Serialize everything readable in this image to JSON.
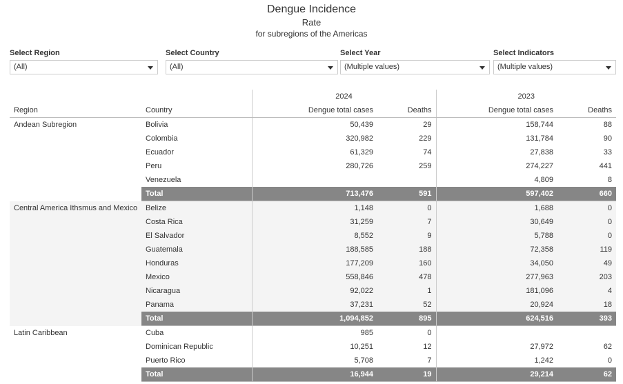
{
  "title": {
    "line1": "Dengue Incidence",
    "line2": "Rate",
    "line3": "for subregions of the Americas"
  },
  "filters": [
    {
      "label": "Select Region",
      "value": "(All)",
      "icon": "chevron-down-icon"
    },
    {
      "label": "Select Country",
      "value": "(All)",
      "icon": "chevron-down-icon"
    },
    {
      "label": "Select Year",
      "value": "(Multiple values)",
      "icon": "chevron-down-icon"
    },
    {
      "label": "Select Indicators",
      "value": "(Multiple values)",
      "icon": "chevron-down-icon"
    }
  ],
  "table": {
    "year_headers": [
      "2024",
      "2023"
    ],
    "column_headers": {
      "region": "Region",
      "country": "Country",
      "cases_2024": "Dengue total cases",
      "deaths_2024": "Deaths",
      "cases_2023": "Dengue total cases",
      "deaths_2023": "Deaths"
    },
    "total_label": "Total",
    "groups": [
      {
        "region": "Andean Subregion",
        "shaded": false,
        "rows": [
          {
            "country": "Bolivia",
            "cases_2024": "50,439",
            "deaths_2024": "29",
            "cases_2023": "158,744",
            "deaths_2023": "88"
          },
          {
            "country": "Colombia",
            "cases_2024": "320,982",
            "deaths_2024": "229",
            "cases_2023": "131,784",
            "deaths_2023": "90"
          },
          {
            "country": "Ecuador",
            "cases_2024": "61,329",
            "deaths_2024": "74",
            "cases_2023": "27,838",
            "deaths_2023": "33"
          },
          {
            "country": "Peru",
            "cases_2024": "280,726",
            "deaths_2024": "259",
            "cases_2023": "274,227",
            "deaths_2023": "441"
          },
          {
            "country": "Venezuela",
            "cases_2024": "",
            "deaths_2024": "",
            "cases_2023": "4,809",
            "deaths_2023": "8"
          }
        ],
        "total": {
          "cases_2024": "713,476",
          "deaths_2024": "591",
          "cases_2023": "597,402",
          "deaths_2023": "660"
        }
      },
      {
        "region": "Central America Ithsmus and Mexico",
        "shaded": true,
        "rows": [
          {
            "country": "Belize",
            "cases_2024": "1,148",
            "deaths_2024": "0",
            "cases_2023": "1,688",
            "deaths_2023": "0"
          },
          {
            "country": "Costa Rica",
            "cases_2024": "31,259",
            "deaths_2024": "7",
            "cases_2023": "30,649",
            "deaths_2023": "0"
          },
          {
            "country": "El Salvador",
            "cases_2024": "8,552",
            "deaths_2024": "9",
            "cases_2023": "5,788",
            "deaths_2023": "0"
          },
          {
            "country": "Guatemala",
            "cases_2024": "188,585",
            "deaths_2024": "188",
            "cases_2023": "72,358",
            "deaths_2023": "119"
          },
          {
            "country": "Honduras",
            "cases_2024": "177,209",
            "deaths_2024": "160",
            "cases_2023": "34,050",
            "deaths_2023": "49"
          },
          {
            "country": "Mexico",
            "cases_2024": "558,846",
            "deaths_2024": "478",
            "cases_2023": "277,963",
            "deaths_2023": "203"
          },
          {
            "country": "Nicaragua",
            "cases_2024": "92,022",
            "deaths_2024": "1",
            "cases_2023": "181,096",
            "deaths_2023": "4"
          },
          {
            "country": "Panama",
            "cases_2024": "37,231",
            "deaths_2024": "52",
            "cases_2023": "20,924",
            "deaths_2023": "18"
          }
        ],
        "total": {
          "cases_2024": "1,094,852",
          "deaths_2024": "895",
          "cases_2023": "624,516",
          "deaths_2023": "393"
        }
      },
      {
        "region": "Latin Caribbean",
        "shaded": false,
        "rows": [
          {
            "country": "Cuba",
            "cases_2024": "985",
            "deaths_2024": "0",
            "cases_2023": "",
            "deaths_2023": ""
          },
          {
            "country": "Dominican Republic",
            "cases_2024": "10,251",
            "deaths_2024": "12",
            "cases_2023": "27,972",
            "deaths_2023": "62"
          },
          {
            "country": "Puerto Rico",
            "cases_2024": "5,708",
            "deaths_2024": "7",
            "cases_2023": "1,242",
            "deaths_2023": "0"
          }
        ],
        "total": {
          "cases_2024": "16,944",
          "deaths_2024": "19",
          "cases_2023": "29,214",
          "deaths_2023": "62"
        }
      }
    ]
  },
  "colors": {
    "total_row_bg": "#868686",
    "alt_row_bg": "#f4f4f4",
    "rule": "#bcbcbc",
    "text": "#333333"
  }
}
